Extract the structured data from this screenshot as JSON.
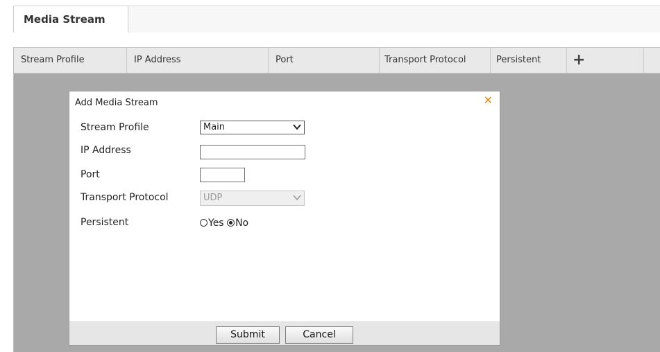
{
  "tabs": [
    {
      "label": "Media Stream"
    }
  ],
  "table": {
    "columns": [
      "Stream Profile",
      "IP Address",
      "Port",
      "Transport Protocol",
      "Persistent"
    ],
    "add_icon": "plus-icon"
  },
  "dialog": {
    "title": "Add Media Stream",
    "close_icon": "close-icon",
    "fields": {
      "stream_profile": {
        "label": "Stream Profile",
        "value": "Main"
      },
      "ip_address": {
        "label": "IP Address",
        "value": ""
      },
      "port": {
        "label": "Port",
        "value": ""
      },
      "transport_protocol": {
        "label": "Transport Protocol",
        "value": "UDP"
      },
      "persistent": {
        "label": "Persistent",
        "options": [
          "Yes",
          "No"
        ],
        "selected": "No"
      }
    },
    "buttons": {
      "submit": "Submit",
      "cancel": "Cancel"
    }
  },
  "colors": {
    "close_icon": "#e08a1c",
    "overlay": "#a9a9a9"
  }
}
